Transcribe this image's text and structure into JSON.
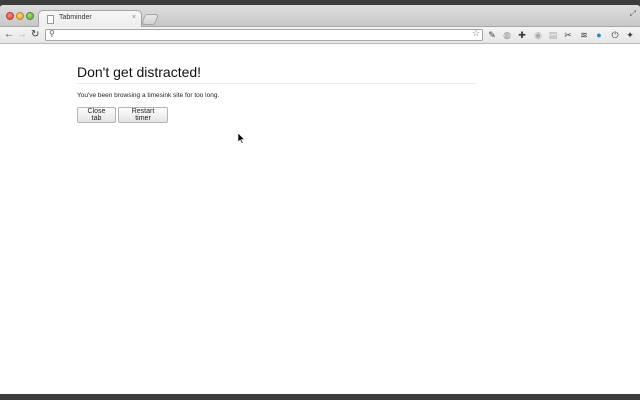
{
  "tabs": [
    {
      "title": "Tabminder",
      "close_glyph": "×"
    }
  ],
  "toolbar": {
    "back_glyph": "←",
    "forward_glyph": "→",
    "reload_glyph": "↻",
    "search_glyph": "⚲",
    "star_glyph": "☆",
    "address_value": "",
    "extensions": [
      {
        "name": "pin-icon",
        "glyph": "✎"
      },
      {
        "name": "globe-icon",
        "glyph": "◍"
      },
      {
        "name": "puzzle-icon",
        "glyph": "✚"
      },
      {
        "name": "shield-icon",
        "glyph": "◉"
      },
      {
        "name": "note-icon",
        "glyph": "▤"
      },
      {
        "name": "wrench-icon",
        "glyph": "✂"
      },
      {
        "name": "layers-icon",
        "glyph": "≋"
      },
      {
        "name": "circle-icon",
        "glyph": "●"
      },
      {
        "name": "power-icon",
        "glyph": "⏻"
      },
      {
        "name": "settings-wrench-icon",
        "glyph": "✦"
      }
    ]
  },
  "page": {
    "headline": "Don't get distracted!",
    "message": "You've been browsing a timesink site for too long.",
    "close_tab_label": "Close tab",
    "restart_timer_label": "Restart timer"
  },
  "colors": {
    "ext_accent": "#1a8fd0"
  }
}
